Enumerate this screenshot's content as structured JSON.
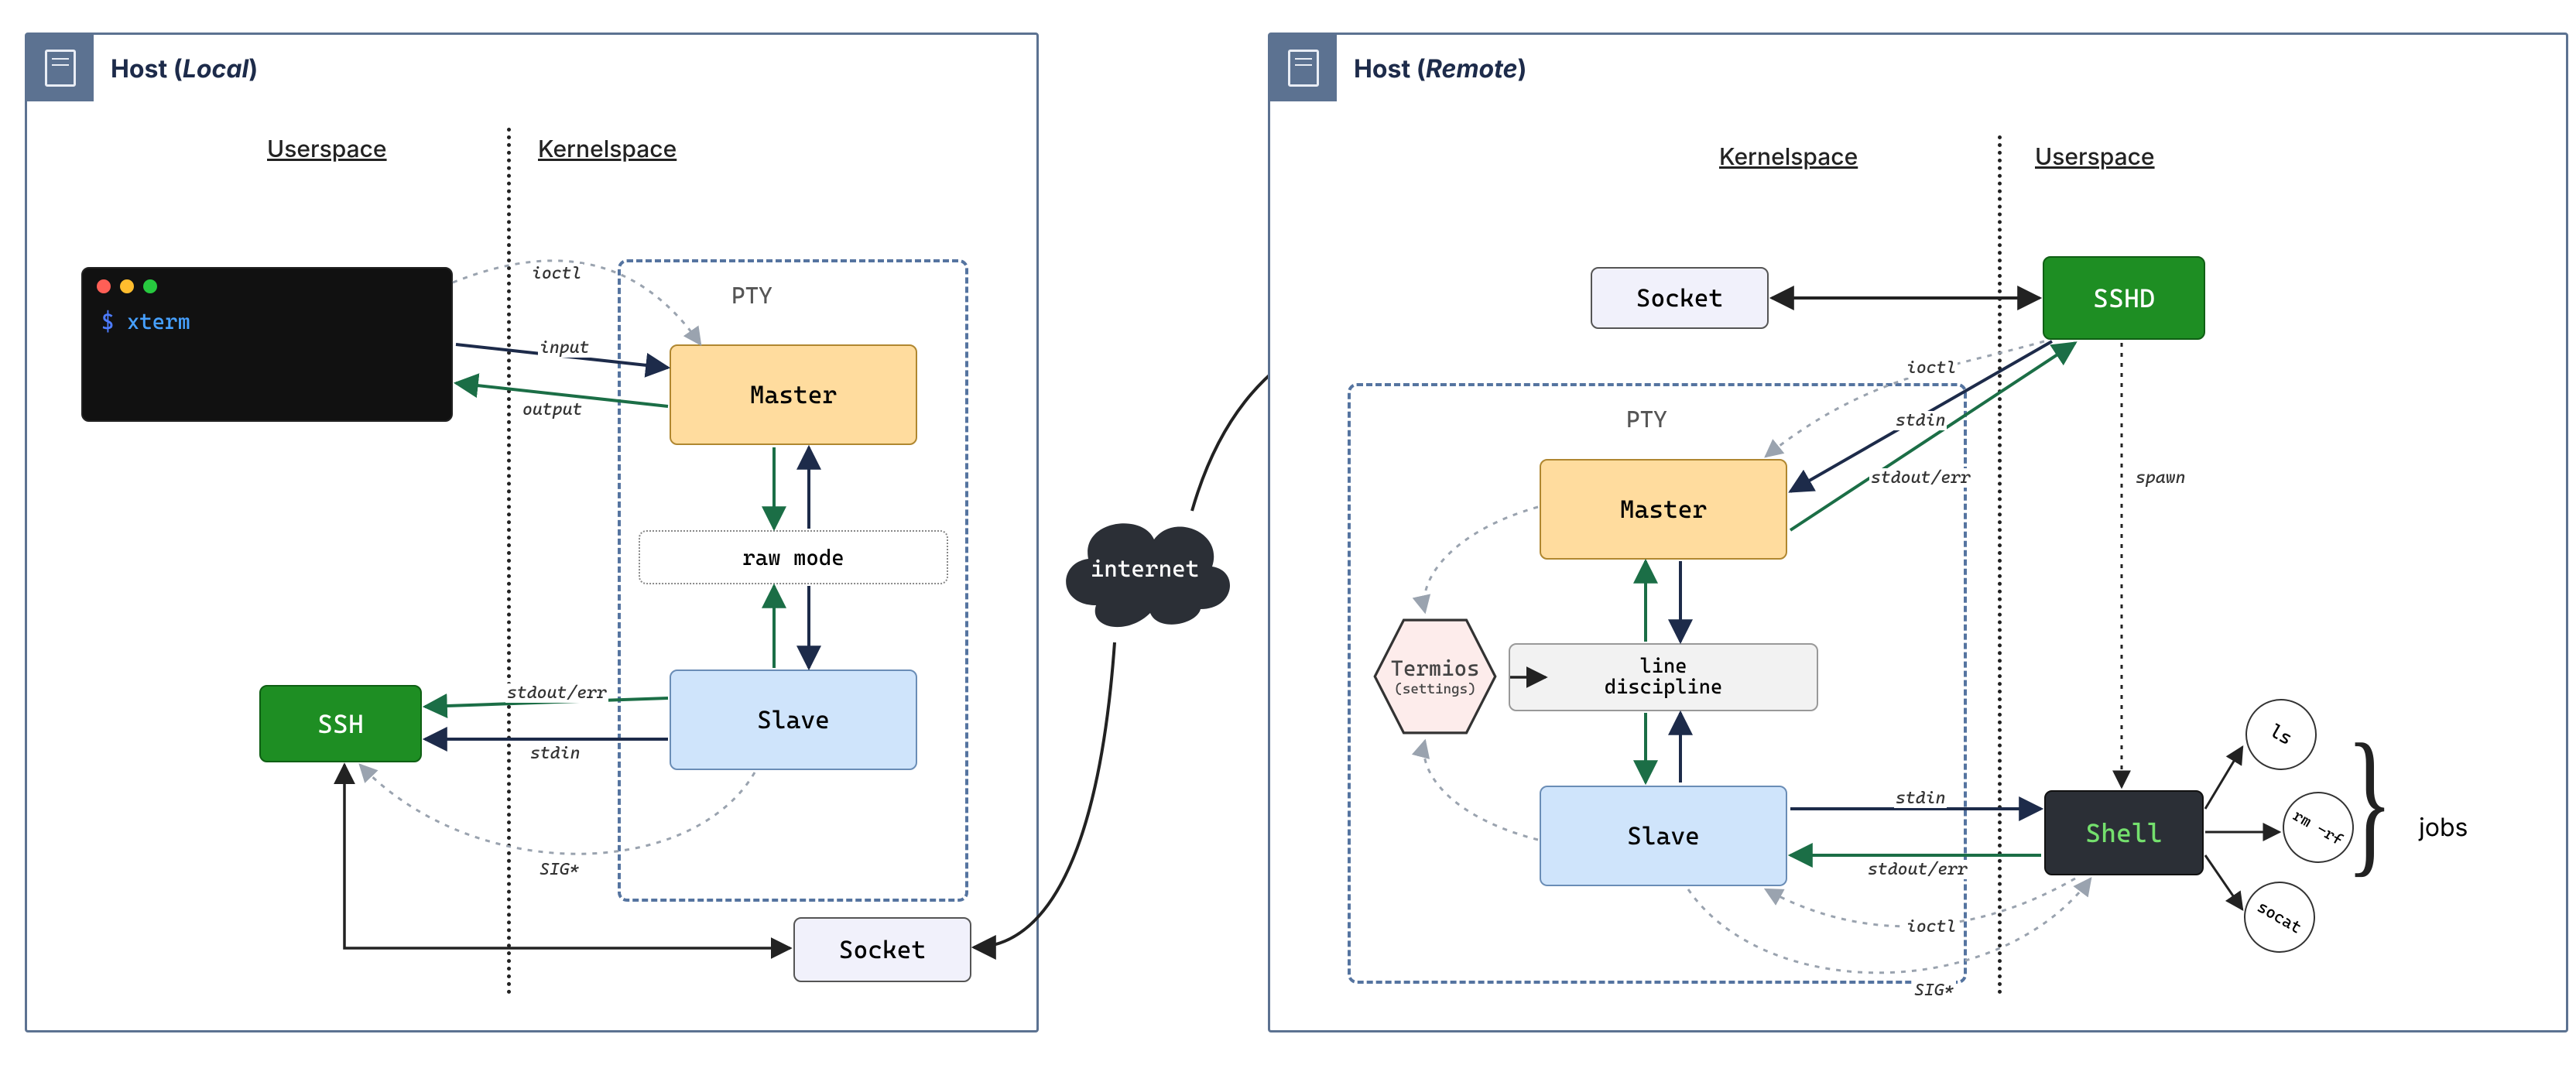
{
  "local": {
    "title_pre": "Host (",
    "title_em": "Local",
    "title_post": ")",
    "userspace": "Userspace",
    "kernelspace": "Kernelspace",
    "xterm_prompt": "$",
    "xterm_cmd": "xterm",
    "pty": "PTY",
    "master": "Master",
    "slave": "Slave",
    "raw_mode": "raw mode",
    "ssh": "SSH",
    "socket": "Socket",
    "edges": {
      "ioctl": "ioctl",
      "input": "input",
      "output": "output",
      "stdout_err": "stdout/err",
      "stdin": "stdin",
      "sig": "SIG*"
    }
  },
  "internet": {
    "label": "internet"
  },
  "remote": {
    "title_pre": "Host (",
    "title_em": "Remote",
    "title_post": ")",
    "userspace": "Userspace",
    "kernelspace": "Kernelspace",
    "socket": "Socket",
    "sshd": "SSHD",
    "pty": "PTY",
    "master": "Master",
    "line_discipline_1": "line",
    "line_discipline_2": "discipline",
    "slave": "Slave",
    "termios": "Termios",
    "termios_sub": "(settings)",
    "shell": "Shell",
    "jobs": [
      "ls",
      "rm -rf",
      "socat"
    ],
    "jobs_label": "jobs",
    "edges": {
      "ioctl": "ioctl",
      "stdin": "stdin",
      "stdout_err": "stdout/err",
      "spawn": "spawn",
      "sig": "SIG*"
    }
  },
  "colors": {
    "host_border": "#5c7291",
    "green_arrow": "#1b6e46",
    "navy_arrow": "#1d2b4a",
    "gray_dotted": "#9aa3af"
  }
}
